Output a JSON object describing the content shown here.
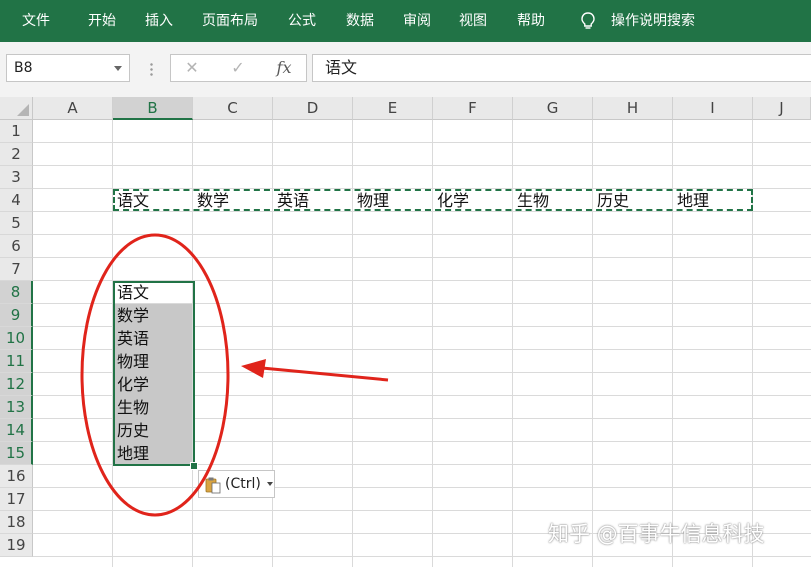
{
  "ribbon": {
    "tabs": [
      "文件",
      "开始",
      "插入",
      "页面布局",
      "公式",
      "数据",
      "审阅",
      "视图",
      "帮助"
    ],
    "search_label": "操作说明搜索"
  },
  "formula_bar": {
    "name_box": "B8",
    "cancel_icon": "✕",
    "enter_icon": "✓",
    "fx_label": "fx",
    "content": "语文"
  },
  "grid": {
    "columns": [
      "A",
      "B",
      "C",
      "D",
      "E",
      "F",
      "G",
      "H",
      "I",
      "J"
    ],
    "selected_column": "B",
    "rows": [
      "1",
      "2",
      "3",
      "4",
      "5",
      "6",
      "7",
      "8",
      "9",
      "10",
      "11",
      "12",
      "13",
      "14",
      "15",
      "16",
      "17",
      "18",
      "19"
    ],
    "selected_rows": [
      "8",
      "9",
      "10",
      "11",
      "12",
      "13",
      "14",
      "15"
    ],
    "row4_values": [
      "语文",
      "数学",
      "英语",
      "物理",
      "化学",
      "生物",
      "历史",
      "地理"
    ],
    "column_b_values": [
      "语文",
      "数学",
      "英语",
      "物理",
      "化学",
      "生物",
      "历史",
      "地理"
    ],
    "active_cell": "B8"
  },
  "paste_options": {
    "label": "(Ctrl)"
  },
  "annotation": {
    "ellipse_color": "#e0241b",
    "arrow_color": "#e0241b"
  },
  "watermark": "知乎 @百事牛信息科技",
  "colors": {
    "ribbon": "#217346",
    "accent": "#217346",
    "selection_shade": "#c8c8c8"
  }
}
